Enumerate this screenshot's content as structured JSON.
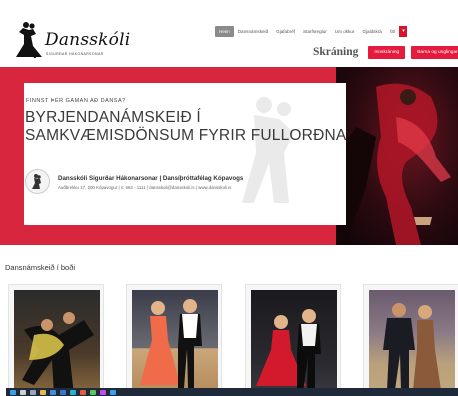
{
  "header": {
    "logo_text": "Dansskóli",
    "logo_sub": "SIGURÐAR HÁKONARSONAR",
    "nav": [
      {
        "label": "Heim",
        "active": true
      },
      {
        "label": "Dansnámskeið",
        "active": false
      },
      {
        "label": "Gjafabréf",
        "active": false
      },
      {
        "label": "Starfsreglur",
        "active": false
      },
      {
        "label": "Um okkur",
        "active": false
      },
      {
        "label": "Gjaldskrá",
        "active": false
      },
      {
        "label": "ÍSÍ",
        "active": false
      }
    ],
    "registration_title": "Skráning",
    "reg_button_1": "Innskráning",
    "reg_button_2": "Barna og unglingar"
  },
  "hero": {
    "eyebrow": "FINNST ÞÉR GAMAN AÐ DANSA?",
    "headline_line1": "BYRJENDANÁMSKEIÐ Í",
    "headline_line2": "SAMKVÆMISDÖNSUM FYRIR FULLORÐNA",
    "school_name": "Dansskóli Sigurðar Hákonarsonar | Dansíþróttafélag Kópavogs",
    "school_address": "Auðbrekku 17, 200 Kópavogur | s: 564 - 1111 | dansskoli@dansskoli.is | www.dansskoli.is",
    "accent_color": "#d7263d"
  },
  "courses": {
    "section_title": "Dansnámskeið í boði",
    "items": [
      {
        "image": "competition-couple-dancing"
      },
      {
        "image": "children-couple-girl-pink-dress"
      },
      {
        "image": "children-couple-girl-red-dress"
      },
      {
        "image": "adult-couple-dancing"
      }
    ]
  },
  "taskbar": {
    "icons": [
      "windows-icon",
      "search-icon",
      "taskview-icon",
      "explorer-icon",
      "store-icon",
      "mail-icon",
      "browser-icon",
      "app-icon",
      "app-icon",
      "app-icon",
      "app-icon"
    ]
  }
}
